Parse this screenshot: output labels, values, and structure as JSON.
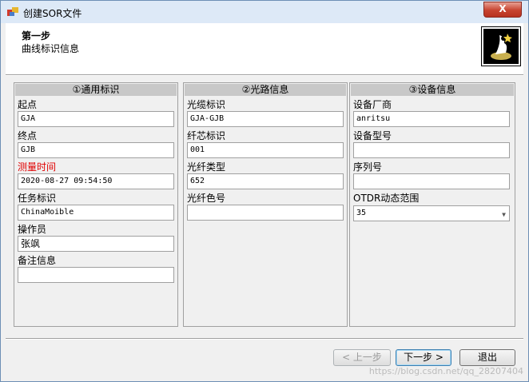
{
  "window": {
    "title": "创建SOR文件",
    "close": "X"
  },
  "header": {
    "step_title": "第一步",
    "step_subtitle": "曲线标识信息"
  },
  "panels": {
    "general": {
      "title": "①通用标识",
      "start_label": "起点",
      "start_value": "GJA",
      "end_label": "终点",
      "end_value": "GJB",
      "time_label": "测量时间",
      "time_value": "2020-08-27 09:54:50",
      "task_label": "任务标识",
      "task_value": "ChinaMoible",
      "operator_label": "操作员",
      "operator_value": "张飒",
      "remark_label": "备注信息",
      "remark_value": ""
    },
    "fiber": {
      "title": "②光路信息",
      "cable_label": "光缆标识",
      "cable_value": "GJA-GJB",
      "core_label": "纤芯标识",
      "core_value": "001",
      "type_label": "光纤类型",
      "type_value": "652",
      "color_label": "光纤色号",
      "color_value": ""
    },
    "device": {
      "title": "③设备信息",
      "vendor_label": "设备厂商",
      "vendor_value": "anritsu",
      "model_label": "设备型号",
      "model_value": "",
      "serial_label": "序列号",
      "serial_value": "",
      "range_label": "OTDR动态范围",
      "range_value": "35",
      "range_arrow": "▼"
    }
  },
  "buttons": {
    "prev": "< 上一步",
    "next": "下一步 >",
    "exit": "退出"
  },
  "watermark": "https://blog.csdn.net/qq_28207404",
  "colors": {
    "highlight_label": "#e00000",
    "titlebar": "#dde9f7",
    "close": "#c7432f"
  },
  "icons": {
    "app": "app-icon",
    "logo": "wizard-logo-icon"
  }
}
